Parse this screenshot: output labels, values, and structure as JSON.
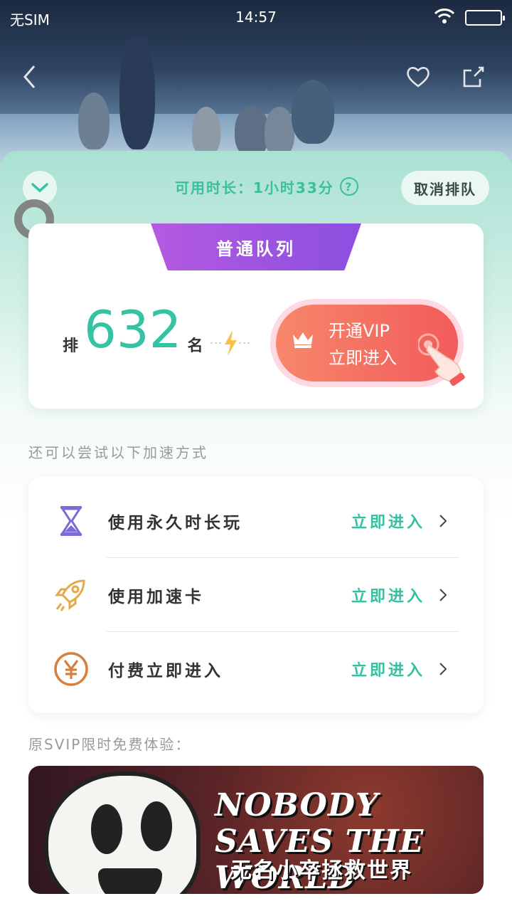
{
  "status_bar": {
    "carrier": "无SIM",
    "time": "14:57"
  },
  "queue": {
    "available_label": "可用时长：1小时33分",
    "cancel_label": "取消排队",
    "queue_tab": "普通队列",
    "rank_prefix": "排",
    "rank_number": "632",
    "rank_suffix": "名",
    "vip_line1": "开通VIP",
    "vip_line2": "立即进入"
  },
  "speedup": {
    "tip": "还可以尝试以下加速方式",
    "options": [
      {
        "label": "使用永久时长玩",
        "action": "立即进入",
        "icon": "hourglass-icon"
      },
      {
        "label": "使用加速卡",
        "action": "立即进入",
        "icon": "rocket-icon"
      },
      {
        "label": "付费立即进入",
        "action": "立即进入",
        "icon": "yuan-coin-icon"
      }
    ]
  },
  "svip": {
    "label": "原SVIP限时免费体验：",
    "banner_title": "NOBODY SAVES THE WORLD",
    "banner_subtitle": "无名小卒拯救世界"
  },
  "colors": {
    "accent_teal": "#35c3a3",
    "queue_purple": "#9b55e0",
    "vip_coral": "#f56d62"
  }
}
